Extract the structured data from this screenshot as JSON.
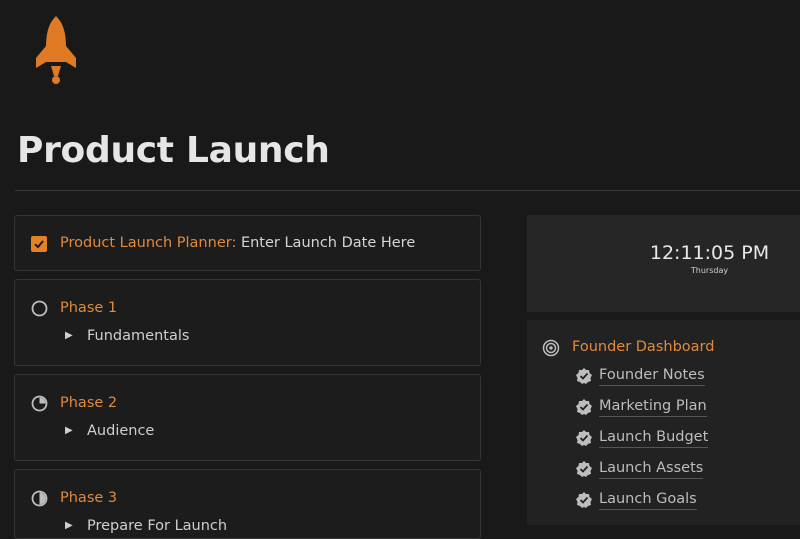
{
  "page": {
    "icon": "rocket-icon",
    "title": "Product Launch"
  },
  "colors": {
    "accent": "#e08a3c",
    "background": "#191919",
    "panel": "#262626"
  },
  "planner": {
    "checked": true,
    "label": "Product Launch Planner:",
    "text": " Enter Launch Date Here"
  },
  "phases": [
    {
      "title": "Phase 1",
      "icon": "empty-circle-icon",
      "toggle_label": "Fundamentals"
    },
    {
      "title": "Phase 2",
      "icon": "quarter-pie-icon",
      "toggle_label": "Audience"
    },
    {
      "title": "Phase 3",
      "icon": "half-pie-icon",
      "toggle_label": "Prepare For Launch"
    }
  ],
  "clock": {
    "time": "12:11:05 PM",
    "day": "Thursday"
  },
  "dashboard": {
    "icon": "target-icon",
    "title": "Founder Dashboard",
    "items": [
      {
        "label": "Founder Notes",
        "icon": "verified-check-icon"
      },
      {
        "label": "Marketing Plan",
        "icon": "verified-check-icon"
      },
      {
        "label": "Launch Budget",
        "icon": "verified-check-icon"
      },
      {
        "label": "Launch Assets",
        "icon": "verified-check-icon"
      },
      {
        "label": "Launch Goals",
        "icon": "verified-check-icon"
      }
    ]
  }
}
